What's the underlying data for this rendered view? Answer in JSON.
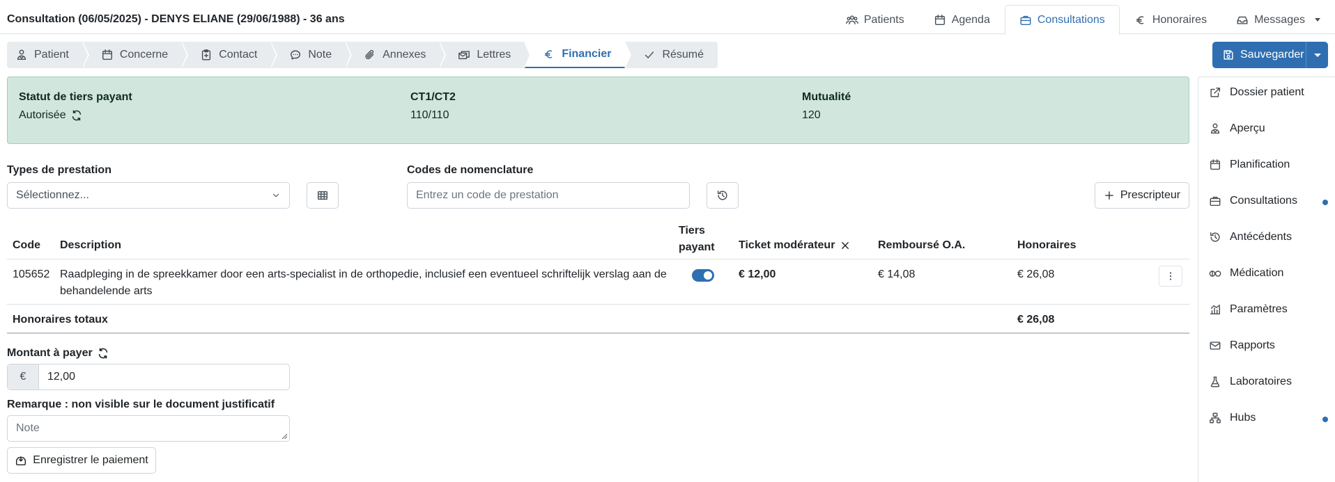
{
  "header": {
    "title": "Consultation (06/05/2025) - DENYS ELIANE (29/06/1988) - 36 ans"
  },
  "topnav": [
    {
      "label": "Patients",
      "icon": "users-icon"
    },
    {
      "label": "Agenda",
      "icon": "calendar-icon"
    },
    {
      "label": "Consultations",
      "icon": "briefcase-icon",
      "active": true
    },
    {
      "label": "Honoraires",
      "icon": "euro-icon"
    },
    {
      "label": "Messages",
      "icon": "inbox-icon"
    }
  ],
  "steps": [
    {
      "label": "Patient",
      "icon": "person-icon"
    },
    {
      "label": "Concerne",
      "icon": "calendar-icon"
    },
    {
      "label": "Contact",
      "icon": "clipboard-plus-icon"
    },
    {
      "label": "Note",
      "icon": "speech-bubble-icon"
    },
    {
      "label": "Annexes",
      "icon": "paperclip-icon"
    },
    {
      "label": "Lettres",
      "icon": "envelopes-icon"
    },
    {
      "label": "Financier",
      "icon": "euro-icon",
      "active": true
    },
    {
      "label": "Résumé",
      "icon": "check-icon"
    }
  ],
  "save": {
    "label": "Sauvegarder"
  },
  "status": {
    "tiers_label": "Statut de tiers payant",
    "tiers_value": "Autorisée",
    "ct_label": "CT1/CT2",
    "ct_value": "110/110",
    "mut_label": "Mutualité",
    "mut_value": "120"
  },
  "form": {
    "types_label": "Types de prestation",
    "types_value": "Sélectionnez...",
    "codes_label": "Codes de nomenclature",
    "codes_placeholder": "Entrez un code de prestation",
    "prescripteur": "Prescripteur"
  },
  "table": {
    "headers": {
      "code": "Code",
      "description": "Description",
      "tiers_line1": "Tiers",
      "tiers_line2": "payant",
      "ticket": "Ticket modérateur",
      "rembourse": "Remboursé O.A.",
      "honoraires": "Honoraires"
    },
    "rows": [
      {
        "code": "105652",
        "description": "Raadpleging in de spreekkamer door een arts-specialist in de orthopedie, inclusief een eventueel schriftelijk verslag aan de behandelende arts",
        "tiers_payant": true,
        "ticket": "€ 12,00",
        "rembourse": "€ 14,08",
        "honoraires": "€ 26,08"
      }
    ],
    "total_label": "Honoraires totaux",
    "total_value": "€ 26,08"
  },
  "payment": {
    "amount_label": "Montant à payer",
    "currency": "€",
    "amount_value": "12,00",
    "remark_label": "Remarque : non visible sur le document justificatif",
    "note_placeholder": "Note",
    "pay_button": "Enregistrer le paiement"
  },
  "sidebar": [
    {
      "label": "Dossier patient",
      "icon": "external-edit-icon",
      "dot": false
    },
    {
      "label": "Aperçu",
      "icon": "person-icon",
      "dot": false
    },
    {
      "label": "Planification",
      "icon": "calendar-icon",
      "dot": false
    },
    {
      "label": "Consultations",
      "icon": "briefcase-icon",
      "dot": true
    },
    {
      "label": "Antécédents",
      "icon": "history-icon",
      "dot": false
    },
    {
      "label": "Médication",
      "icon": "pills-icon",
      "dot": false
    },
    {
      "label": "Paramètres",
      "icon": "bar-chart-icon",
      "dot": false
    },
    {
      "label": "Rapports",
      "icon": "envelope-icon",
      "dot": false
    },
    {
      "label": "Laboratoires",
      "icon": "flask-icon",
      "dot": false
    },
    {
      "label": "Hubs",
      "icon": "network-icon",
      "dot": true
    }
  ],
  "colors": {
    "accent": "#2f6fb1",
    "status_bg": "#d1e7dd",
    "step_bg": "#e9ecef"
  }
}
